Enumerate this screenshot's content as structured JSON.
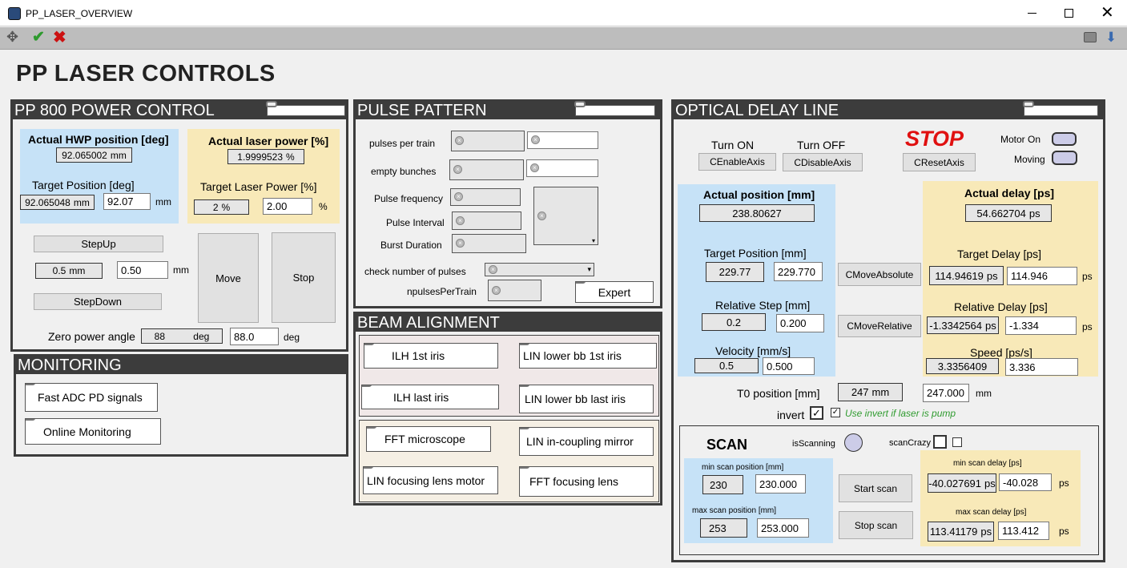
{
  "window": {
    "title": "PP_LASER_OVERVIEW"
  },
  "page_title": "PP LASER CONTROLS",
  "power": {
    "title": "PP 800 POWER CONTROL",
    "hwp_actual_label": "Actual HWP position [deg]",
    "hwp_actual_value": "92.065002",
    "hwp_actual_unit": "mm",
    "laser_actual_label": "Actual laser power [%]",
    "laser_actual_value": "1.9999523",
    "laser_actual_unit": "%",
    "target_pos_label": "Target Position [deg]",
    "target_pos_value": "92.065048",
    "target_pos_value_unit": "mm",
    "target_pos_input": "92.07",
    "target_pos_unit": "mm",
    "target_power_label": "Target Laser Power [%]",
    "target_power_value": "2",
    "target_power_value_unit": "%",
    "target_power_input": "2.00",
    "target_power_unit": "%",
    "stepup": "StepUp",
    "stepdown": "StepDown",
    "step_value": "0.5",
    "step_value_unit": "mm",
    "step_input": "0.50",
    "step_unit": "mm",
    "move": "Move",
    "stop": "Stop",
    "zero_label": "Zero power angle",
    "zero_value": "88",
    "zero_value_unit": "deg",
    "zero_input": "88.0",
    "zero_unit": "deg"
  },
  "monitoring": {
    "title": "MONITORING",
    "fast_adc": "Fast ADC PD signals",
    "online": "Online Monitoring"
  },
  "pulse": {
    "title": "PULSE PATTERN",
    "pulses_per_train": "pulses per train",
    "empty_bunches": "empty bunches",
    "pulse_frequency": "Pulse frequency",
    "pulse_interval": "Pulse Interval",
    "burst_duration": "Burst Duration",
    "check_number": "check number of pulses",
    "npulses": "npulsesPerTrain",
    "expert": "Expert"
  },
  "beam": {
    "title": "BEAM ALIGNMENT",
    "ilh_1st": "ILH 1st iris",
    "lin_lower_1st": "LIN lower bb 1st iris",
    "ilh_last": "ILH last iris",
    "lin_lower_last": "LIN lower bb last iris",
    "fft_microscope": "FFT microscope",
    "lin_incoupling": "LIN in-coupling mirror",
    "lin_focusing": "LIN focusing lens motor",
    "fft_focusing": "FFT focusing lens"
  },
  "odl": {
    "title": "OPTICAL DELAY LINE",
    "turn_on": "Turn ON",
    "turn_off": "Turn OFF",
    "enable": "CEnableAxis",
    "disable": "CDisableAxis",
    "stop_label": "STOP",
    "reset": "CResetAxis",
    "motor_on": "Motor On",
    "moving": "Moving",
    "actual_pos_label": "Actual position [mm]",
    "actual_pos_value": "238.80627",
    "actual_delay_label": "Actual delay [ps]",
    "actual_delay_value": "54.662704",
    "actual_delay_unit": "ps",
    "target_pos_label": "Target Position [mm]",
    "target_pos_value": "229.77",
    "target_pos_input": "229.770",
    "target_delay_label": "Target Delay [ps]",
    "target_delay_value": "114.94619",
    "target_delay_value_unit": "ps",
    "target_delay_input": "114.946",
    "target_delay_unit": "ps",
    "move_abs": "CMoveAbsolute",
    "rel_step_label": "Relative Step [mm]",
    "rel_step_value": "0.2",
    "rel_step_input": "0.200",
    "rel_delay_label": "Relative Delay [ps]",
    "rel_delay_value": "-1.3342564",
    "rel_delay_value_unit": "ps",
    "rel_delay_input": "-1.334",
    "rel_delay_unit": "ps",
    "move_rel": "CMoveRelative",
    "velocity_label": "Velocity [mm/s]",
    "velocity_value": "0.5",
    "velocity_input": "0.500",
    "speed_label": "Speed [ps/s]",
    "speed_value": "3.3356409",
    "speed_input": "3.336",
    "t0_label": "T0 position [mm]",
    "t0_value": "247",
    "t0_value_unit": "mm",
    "t0_input": "247.000",
    "t0_unit": "mm",
    "invert_label": "invert",
    "use_invert": "Use invert if laser is pump"
  },
  "scan": {
    "title": "SCAN",
    "is_scanning": "isScanning",
    "scan_crazy": "scanCrazy",
    "min_pos_label": "min scan position [mm]",
    "min_pos_value": "230",
    "min_pos_input": "230.000",
    "max_pos_label": "max scan position [mm]",
    "max_pos_value": "253",
    "max_pos_input": "253.000",
    "start": "Start scan",
    "stop": "Stop scan",
    "min_delay_label": "min scan delay [ps]",
    "min_delay_value": "-40.027691",
    "min_delay_value_unit": "ps",
    "min_delay_input": "-40.028",
    "min_delay_unit": "ps",
    "max_delay_label": "max scan delay [ps]",
    "max_delay_value": "113.41179",
    "max_delay_value_unit": "ps",
    "max_delay_input": "113.412",
    "max_delay_unit": "ps"
  }
}
